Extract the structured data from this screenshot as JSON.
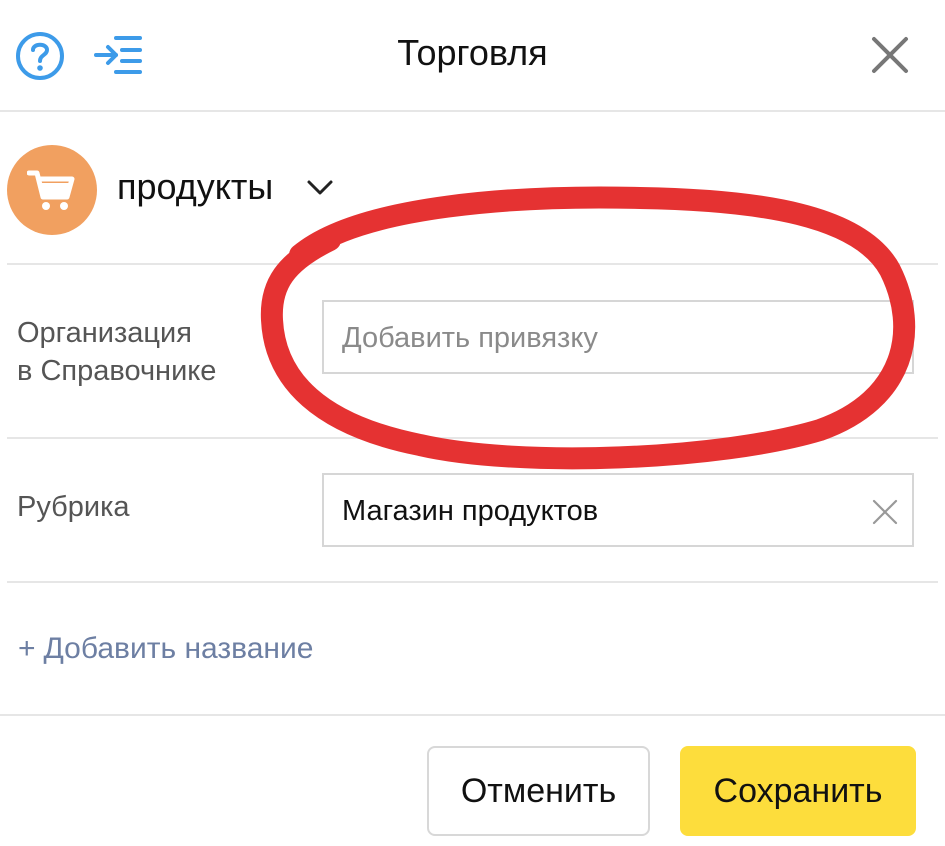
{
  "header": {
    "title": "Торговля",
    "icons": [
      "help-icon",
      "sidebar-collapse-icon",
      "close-icon"
    ]
  },
  "category": {
    "label": "продукты",
    "icon": "shopping-cart-icon",
    "avatar_color": "#f1a060"
  },
  "organization": {
    "label_line1": "Организация",
    "label_line2": "в Справочнике",
    "placeholder": "Добавить привязку"
  },
  "rubric": {
    "label": "Рубрика",
    "value": "Магазин продуктов"
  },
  "add_name": {
    "plus": "+",
    "label": "Добавить название"
  },
  "footer": {
    "cancel_label": "Отменить",
    "save_label": "Сохранить",
    "save_color": "#fddd3c"
  },
  "accent_color": "#3d9be9",
  "annotation_color": "#e53232"
}
